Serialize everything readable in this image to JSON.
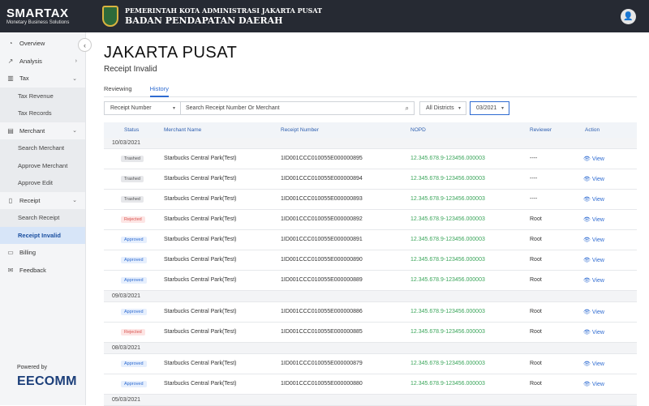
{
  "brand": {
    "name": "SMARTAX",
    "tagline": "Monetary Business Solutions"
  },
  "header": {
    "line1": "PEMERINTAH KOTA ADMINISTRASI JAKARTA PUSAT",
    "line2": "BADAN PENDAPATAN DAERAH"
  },
  "sidebar": {
    "overview": "Overview",
    "analysis": "Analysis",
    "tax": "Tax",
    "tax_revenue": "Tax Revenue",
    "tax_records": "Tax Records",
    "merchant": "Merchant",
    "search_merchant": "Search Merchant",
    "approve_merchant": "Approve Merchant",
    "approve_edit": "Approve Edit",
    "receipt": "Receipt",
    "search_receipt": "Search Receipt",
    "receipt_invalid": "Receipt Invalid",
    "billing": "Billing",
    "feedback": "Feedback"
  },
  "footer": {
    "powered": "Powered by",
    "company": "EECOMM"
  },
  "page": {
    "title": "JAKARTA PUSAT",
    "subtitle": "Receipt Invalid"
  },
  "tabs": {
    "reviewing": "Reviewing",
    "history": "History"
  },
  "filters": {
    "search_by": "Receipt Number",
    "search_placeholder": "Search Receipt Number Or Merchant",
    "district": "All Districts",
    "period": "03/2021"
  },
  "columns": {
    "status": "Status",
    "merchant": "Merchant Name",
    "receipt": "Receipt Number",
    "nopd": "NOPD",
    "reviewer": "Reviewer",
    "action": "Action"
  },
  "groups": [
    {
      "date": "10/03/2021",
      "rows": [
        {
          "status": "Trashed",
          "merchant": "Starbucks Central Park(Test)",
          "receipt": "1ID001CCC010055E000000895",
          "nopd": "12.345.678.9-123456.000003",
          "reviewer": "----",
          "action": "View"
        },
        {
          "status": "Trashed",
          "merchant": "Starbucks Central Park(Test)",
          "receipt": "1ID001CCC010055E000000894",
          "nopd": "12.345.678.9-123456.000003",
          "reviewer": "----",
          "action": "View"
        },
        {
          "status": "Trashed",
          "merchant": "Starbucks Central Park(Test)",
          "receipt": "1ID001CCC010055E000000893",
          "nopd": "12.345.678.9-123456.000003",
          "reviewer": "----",
          "action": "View"
        },
        {
          "status": "Rejected",
          "merchant": "Starbucks Central Park(Test)",
          "receipt": "1ID001CCC010055E000000892",
          "nopd": "12.345.678.9-123456.000003",
          "reviewer": "Root",
          "action": "View"
        },
        {
          "status": "Approved",
          "merchant": "Starbucks Central Park(Test)",
          "receipt": "1ID001CCC010055E000000891",
          "nopd": "12.345.678.9-123456.000003",
          "reviewer": "Root",
          "action": "View"
        },
        {
          "status": "Approved",
          "merchant": "Starbucks Central Park(Test)",
          "receipt": "1ID001CCC010055E000000890",
          "nopd": "12.345.678.9-123456.000003",
          "reviewer": "Root",
          "action": "View"
        },
        {
          "status": "Approved",
          "merchant": "Starbucks Central Park(Test)",
          "receipt": "1ID001CCC010055E000000889",
          "nopd": "12.345.678.9-123456.000003",
          "reviewer": "Root",
          "action": "View"
        }
      ]
    },
    {
      "date": "09/03/2021",
      "rows": [
        {
          "status": "Approved",
          "merchant": "Starbucks Central Park(Test)",
          "receipt": "1ID001CCC010055E000000886",
          "nopd": "12.345.678.9-123456.000003",
          "reviewer": "Root",
          "action": "View"
        },
        {
          "status": "Rejected",
          "merchant": "Starbucks Central Park(Test)",
          "receipt": "1ID001CCC010055E000000885",
          "nopd": "12.345.678.9-123456.000003",
          "reviewer": "Root",
          "action": "View"
        }
      ]
    },
    {
      "date": "08/03/2021",
      "rows": [
        {
          "status": "Approved",
          "merchant": "Starbucks Central Park(Test)",
          "receipt": "1ID001CCC010055E000000879",
          "nopd": "12.345.678.9-123456.000003",
          "reviewer": "Root",
          "action": "View"
        },
        {
          "status": "Approved",
          "merchant": "Starbucks Central Park(Test)",
          "receipt": "1ID001CCC010055E000000880",
          "nopd": "12.345.678.9-123456.000003",
          "reviewer": "Root",
          "action": "View"
        }
      ]
    },
    {
      "date": "05/03/2021",
      "rows": []
    }
  ],
  "colors": {
    "accent": "#2e6bd1",
    "nopd": "#3aa55a",
    "topbar": "#262a33"
  }
}
